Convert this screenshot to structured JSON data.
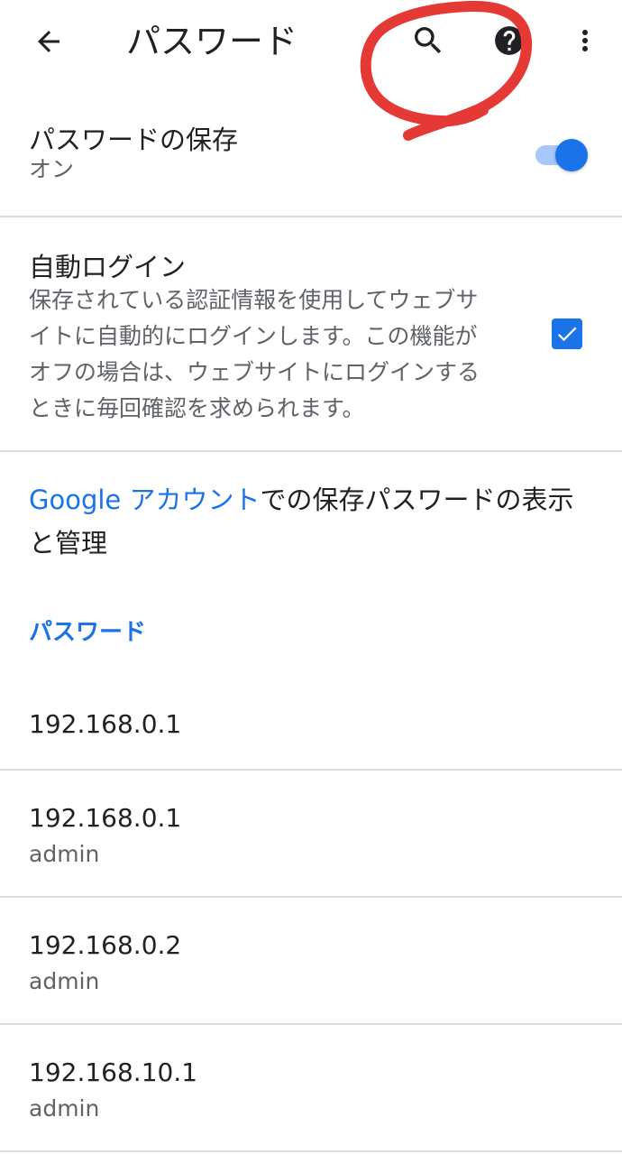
{
  "toolbar": {
    "title": "パスワード",
    "icons": {
      "back": "back-arrow-icon",
      "search": "search-icon",
      "help": "help-icon",
      "more": "more-vert-icon"
    }
  },
  "save_passwords": {
    "title": "パスワードの保存",
    "summary": "オン",
    "enabled": true
  },
  "auto_signin": {
    "title": "自動ログイン",
    "summary_lines": [
      "保存されている認証情報を使用してウェブサ",
      "イトに自動的にログインします。この機能が",
      "オフの場合は、ウェブサイトにログインする",
      "ときに毎回確認を求められます。"
    ],
    "checked": true
  },
  "account": {
    "link_text": "Google アカウント",
    "rest_text": "での保存パスワードの表示と管理"
  },
  "passwords_section": {
    "header": "パスワード",
    "items": [
      {
        "site": "192.168.0.1",
        "username": ""
      },
      {
        "site": "192.168.0.1",
        "username": "admin"
      },
      {
        "site": "192.168.0.2",
        "username": "admin"
      },
      {
        "site": "192.168.10.1",
        "username": "admin"
      }
    ]
  },
  "colors": {
    "accent": "#1a73e8",
    "annotation": "#e53935",
    "divider": "#dadce0"
  }
}
